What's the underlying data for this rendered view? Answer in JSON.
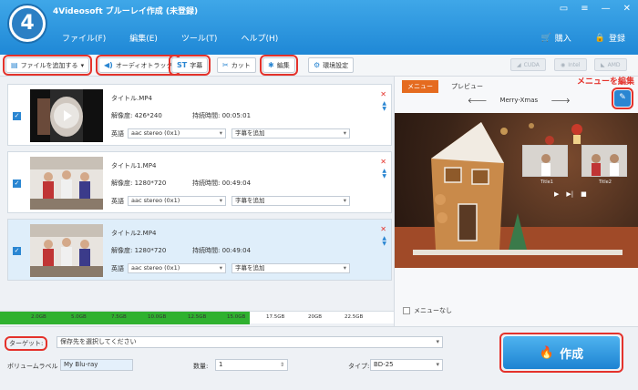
{
  "titlebar": {
    "logo": "4",
    "title": "4Videosoft ブルーレイ作成 (未登録)",
    "menu": [
      "ファイル(F)",
      "編集(E)",
      "ツール(T)",
      "ヘルプ(H)"
    ],
    "buy": "購入",
    "register": "登録"
  },
  "toolbar": {
    "add_file": "ファイルを追加する",
    "audio_track": "オーディオトラック",
    "subtitle": "字幕",
    "cut": "カット",
    "edit": "編集",
    "settings": "環境設定",
    "accel": [
      "CUDA",
      "Intel",
      "AMD"
    ]
  },
  "files": [
    {
      "name": "タイトル.MP4",
      "res_label": "解像度:",
      "res": "426*240",
      "dur_label": "持続時間:",
      "dur": "00:05:01",
      "lang": "英語",
      "audio": "aac stereo (0x1)",
      "subtitle": "字幕を追加"
    },
    {
      "name": "タイトル1.MP4",
      "res_label": "解像度:",
      "res": "1280*720",
      "dur_label": "持続時間:",
      "dur": "00:49:04",
      "lang": "英語",
      "audio": "aac stereo (0x1)",
      "subtitle": "字幕を追加"
    },
    {
      "name": "タイトル2.MP4",
      "res_label": "解像度:",
      "res": "1280*720",
      "dur_label": "持続時間:",
      "dur": "00:49:04",
      "lang": "英語",
      "audio": "aac stereo (0x1)",
      "subtitle": "字幕を追加"
    }
  ],
  "capacity": {
    "fill_fraction": 0.635,
    "ticks": [
      "2.0GB",
      "5.0GB",
      "7.5GB",
      "10.0GB",
      "12.5GB",
      "15.0GB",
      "17.5GB",
      "20GB",
      "22.5GB"
    ]
  },
  "preview": {
    "tab_menu": "メニュー",
    "tab_preview": "プレビュー",
    "edit_note": "メニューを編集",
    "template": "Merry-Xmas",
    "mini1": "Title1",
    "mini2": "Title2",
    "menu_none": "メニューなし"
  },
  "bottom": {
    "target_label": "ターゲット:",
    "target_value": "保存先を選択してください",
    "volume_label": "ボリュームラベル",
    "volume_value": "My Blu-ray",
    "count_label": "数量:",
    "count_value": "1",
    "type_label": "タイプ:",
    "type_value": "BD-25",
    "burn": "作成"
  },
  "colors": {
    "accent": "#2a86d2",
    "highlight": "#e4322b",
    "capacity": "#2fb12f",
    "preview_tab": "#e56b1f"
  }
}
